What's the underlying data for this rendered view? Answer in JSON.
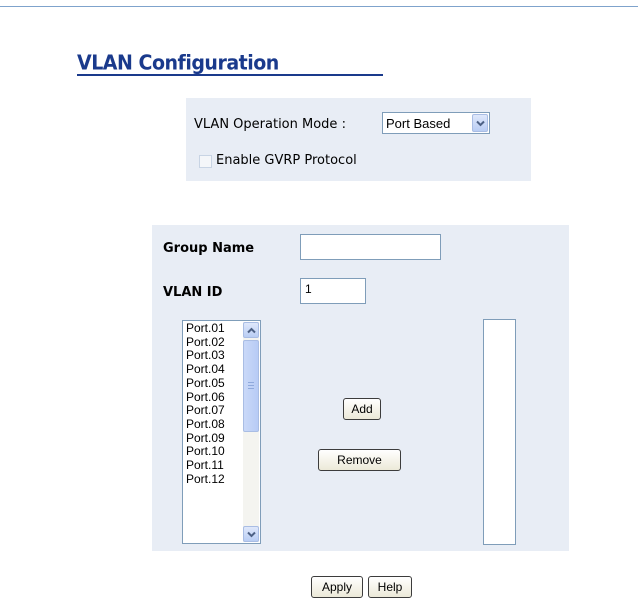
{
  "page": {
    "title": "VLAN Configuration"
  },
  "mode": {
    "label": "VLAN Operation Mode :",
    "selected": "Port Based",
    "gvrp_label": "Enable GVRP Protocol",
    "gvrp_checked": false
  },
  "group": {
    "group_name_label": "Group Name",
    "group_name_value": "",
    "vlan_id_label": "VLAN ID",
    "vlan_id_value": "1",
    "available_ports": [
      "Port.01",
      "Port.02",
      "Port.03",
      "Port.04",
      "Port.05",
      "Port.06",
      "Port.07",
      "Port.08",
      "Port.09",
      "Port.10",
      "Port.11",
      "Port.12"
    ],
    "member_ports": [],
    "add_label": "Add",
    "remove_label": "Remove"
  },
  "footer": {
    "apply_label": "Apply",
    "help_label": "Help"
  },
  "colors": {
    "title": "#1a3a8c",
    "panel_bg": "#e8edf5"
  }
}
